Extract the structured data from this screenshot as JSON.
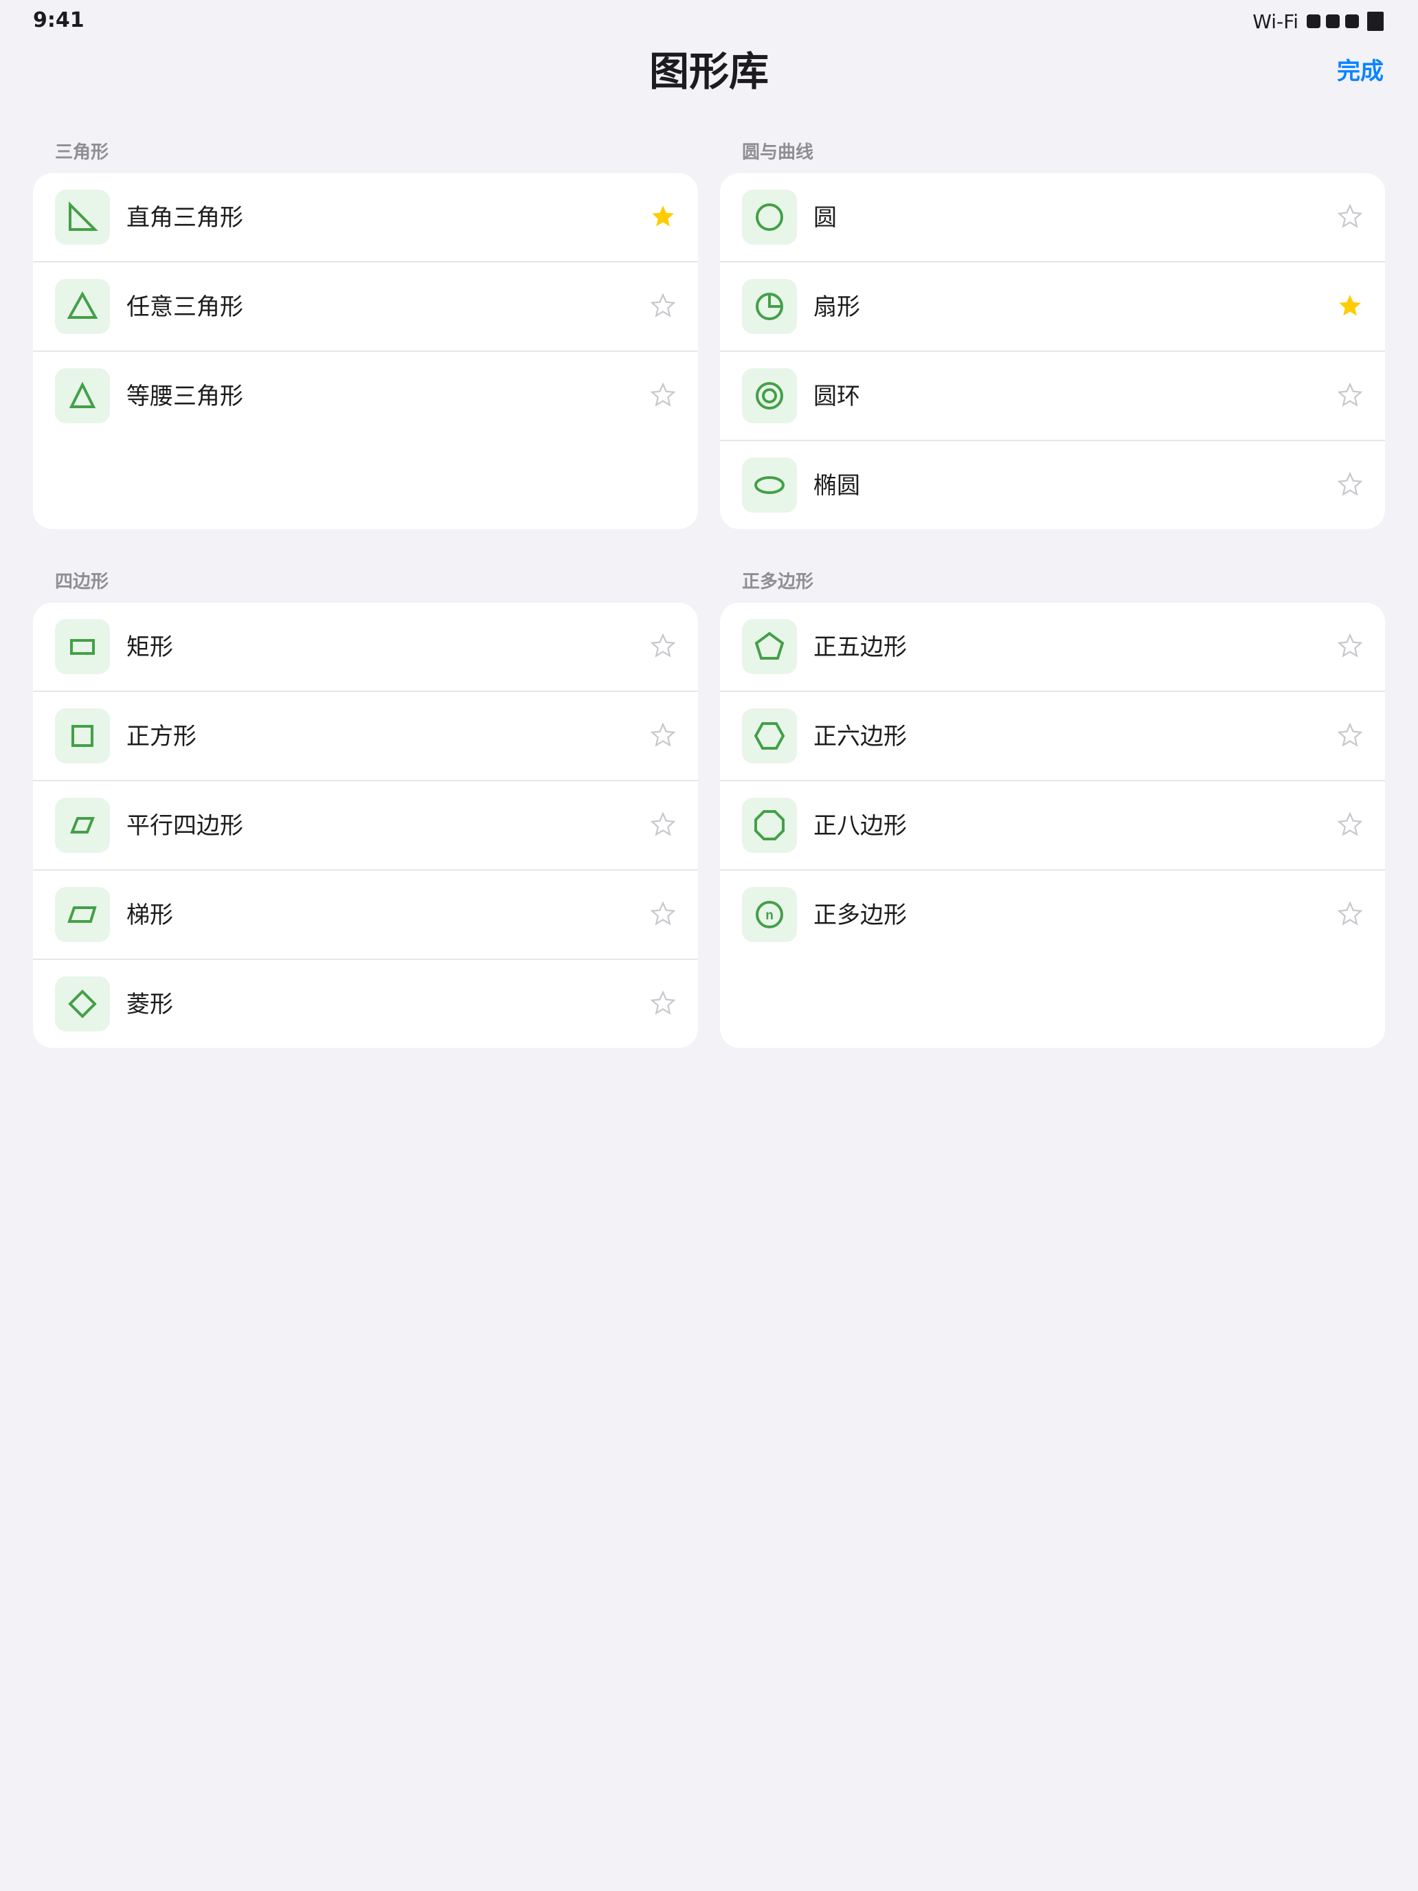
{
  "status": {
    "time": "9:41",
    "wifi": "Wi-Fi"
  },
  "header": {
    "title": "图形库",
    "done_label": "完成"
  },
  "colors": {
    "accent": "#0a84ff",
    "shape_green": "#43a047",
    "icon_tile_bg": "#e8f5e9",
    "star_active": "#ffcc00",
    "star_inactive": "#c7c7cc"
  },
  "sections": [
    {
      "title": "三角形",
      "items": [
        {
          "label": "直角三角形",
          "icon": "right-triangle-icon",
          "starred": true
        },
        {
          "label": "任意三角形",
          "icon": "triangle-icon",
          "starred": false
        },
        {
          "label": "等腰三角形",
          "icon": "isosceles-triangle-icon",
          "starred": false
        }
      ]
    },
    {
      "title": "圆与曲线",
      "items": [
        {
          "label": "圆",
          "icon": "circle-icon",
          "starred": false
        },
        {
          "label": "扇形",
          "icon": "sector-icon",
          "starred": true
        },
        {
          "label": "圆环",
          "icon": "ring-icon",
          "starred": false
        },
        {
          "label": "椭圆",
          "icon": "ellipse-icon",
          "starred": false
        }
      ]
    },
    {
      "title": "四边形",
      "items": [
        {
          "label": "矩形",
          "icon": "rectangle-icon",
          "starred": false
        },
        {
          "label": "正方形",
          "icon": "square-icon",
          "starred": false
        },
        {
          "label": "平行四边形",
          "icon": "parallelogram-icon",
          "starred": false
        },
        {
          "label": "梯形",
          "icon": "trapezoid-icon",
          "starred": false
        },
        {
          "label": "菱形",
          "icon": "rhombus-icon",
          "starred": false
        }
      ]
    },
    {
      "title": "正多边形",
      "items": [
        {
          "label": "正五边形",
          "icon": "pentagon-icon",
          "starred": false
        },
        {
          "label": "正六边形",
          "icon": "hexagon-icon",
          "starred": false
        },
        {
          "label": "正八边形",
          "icon": "octagon-icon",
          "starred": false
        },
        {
          "label": "正多边形",
          "icon": "regular-polygon-n-icon",
          "icon_text": "n",
          "starred": false
        }
      ]
    }
  ]
}
